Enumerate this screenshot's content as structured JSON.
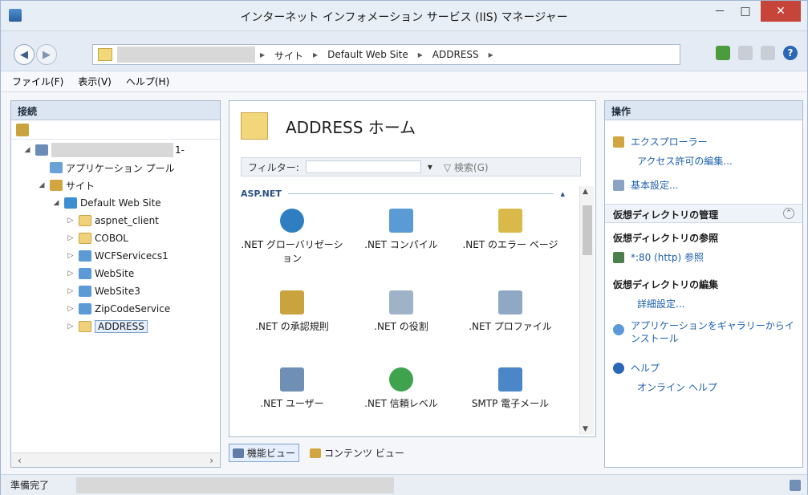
{
  "window": {
    "title": "インターネット インフォメーション サービス (IIS) マネージャー",
    "minimize": "－",
    "maximize": "□",
    "close": "✕"
  },
  "address": {
    "crumbs": [
      "サイト",
      "Default Web Site",
      "ADDRESS"
    ],
    "separator": "▸"
  },
  "menu": {
    "items": [
      "ファイル(F)",
      "表示(V)",
      "ヘルプ(H)"
    ]
  },
  "connections": {
    "header": "接続",
    "server_suffix": "1-",
    "tree": [
      {
        "label": "アプリケーション プール",
        "icon": "app-pool-icon"
      },
      {
        "label": "サイト",
        "icon": "sites-icon"
      },
      {
        "label": "Default Web Site",
        "icon": "globe-icon"
      },
      {
        "label": "aspnet_client",
        "icon": "folder-icon"
      },
      {
        "label": "COBOL",
        "icon": "folder-icon"
      },
      {
        "label": "WCFServicecs1",
        "icon": "application-icon"
      },
      {
        "label": "WebSite",
        "icon": "application-icon"
      },
      {
        "label": "WebSite3",
        "icon": "application-icon"
      },
      {
        "label": "ZipCodeService",
        "icon": "application-icon"
      },
      {
        "label": "ADDRESS",
        "icon": "folder-icon"
      }
    ]
  },
  "home": {
    "title": "ADDRESS ホーム",
    "filter_label": "フィルター:",
    "search_label": "検索(G)",
    "group": "ASP.NET",
    "features": [
      {
        "label": ".NET グローバリゼーション",
        "icon": "globalization-icon",
        "color": "#2f7ec2"
      },
      {
        "label": ".NET コンパイル",
        "icon": "compilation-icon",
        "color": "#5a9bd6"
      },
      {
        "label": ".NET のエラー ページ",
        "icon": "error-pages-icon",
        "color": "#d9b94a"
      },
      {
        "label": ".NET の承認規則",
        "icon": "authorization-rules-icon",
        "color": "#c9a33d"
      },
      {
        "label": ".NET の役割",
        "icon": "roles-icon",
        "color": "#9fb3c8"
      },
      {
        "label": ".NET プロファイル",
        "icon": "profile-icon",
        "color": "#8fa9c4"
      },
      {
        "label": ".NET ユーザー",
        "icon": "users-icon",
        "color": "#6f8fb5"
      },
      {
        "label": ".NET 信頼レベル",
        "icon": "trust-levels-icon",
        "color": "#3fa34d"
      },
      {
        "label": "SMTP 電子メール",
        "icon": "smtp-email-icon",
        "color": "#4a86c8"
      }
    ]
  },
  "views": {
    "features": "機能ビュー",
    "content": "コンテンツ ビュー"
  },
  "actions": {
    "header": "操作",
    "explorer": "エクスプローラー",
    "edit_permissions": "アクセス許可の編集...",
    "basic_settings": "基本設定...",
    "vdir_manage": "仮想ディレクトリの管理",
    "vdir_browse": "仮想ディレクトリの参照",
    "browse_link": "*:80 (http) 参照",
    "vdir_edit": "仮想ディレクトリの編集",
    "advanced": "詳細設定...",
    "install_gallery": "アプリケーションをギャラリーからインストール",
    "help": "ヘルプ",
    "online_help": "オンライン ヘルプ"
  },
  "status": {
    "text": "準備完了"
  }
}
